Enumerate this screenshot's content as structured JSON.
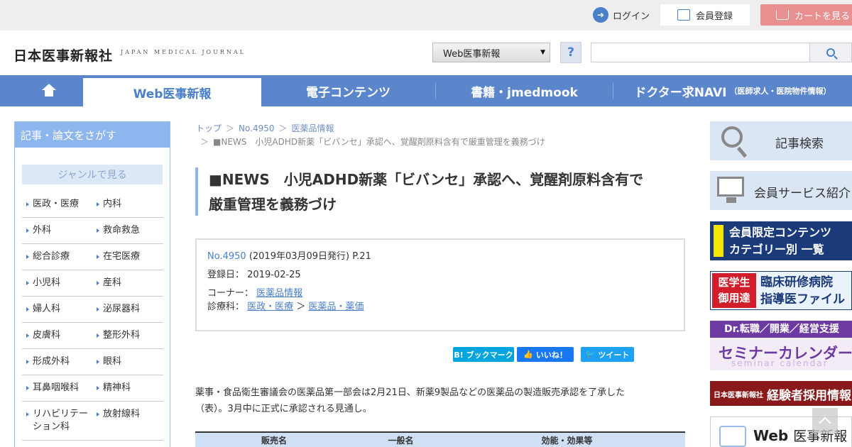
{
  "topbar": {
    "login": "ログイン",
    "register": "会員登録",
    "cart": "カートを見る"
  },
  "header": {
    "logo": "日本医事新報社",
    "logo_en": "JAPAN MEDICAL JOURNAL",
    "select_value": "Web医事新報",
    "help": "?",
    "search_placeholder": ""
  },
  "nav": {
    "items": [
      {
        "label": "Web医事新報"
      },
      {
        "label": "電子コンテンツ"
      },
      {
        "label": "書籍・jmedmook"
      },
      {
        "label": "ドクター求NAVI",
        "sub": "（医師求人・医院物件情報）"
      }
    ]
  },
  "sidebar": {
    "heading": "記事・論文をさがす",
    "genre_label": "ジャンルで見る",
    "categories": [
      [
        "医政・医療",
        "内科"
      ],
      [
        "外科",
        "救命救急"
      ],
      [
        "総合診療",
        "在宅医療"
      ],
      [
        "小児科",
        "産科"
      ],
      [
        "婦人科",
        "泌尿器科"
      ],
      [
        "皮膚科",
        "整形外科"
      ],
      [
        "形成外科",
        "眼科"
      ],
      [
        "耳鼻咽喉科",
        "精神科"
      ],
      [
        "リハビリテーション科",
        "放射線科"
      ]
    ]
  },
  "breadcrumb": {
    "items": [
      "トップ",
      "No.4950",
      "医薬品情報"
    ],
    "sep": "＞",
    "current": "■NEWS　小児ADHD新薬「ビバンセ」承認へ、覚醒剤原料含有で厳重管理を義務づけ"
  },
  "article": {
    "title_line1": "■NEWS　小児ADHD新薬「ビバンセ」承認へ、覚醒剤原料含有で",
    "title_line2": "厳重管理を義務づけ",
    "issue_link": "No.4950",
    "issue_meta": "(2019年03月09日発行) P.21",
    "registered_label": "登録日：",
    "registered_value": "2019-02-25",
    "corner_label": "コーナー：",
    "corner_value": "医薬品情報",
    "dept_label": "診療科：",
    "dept_value1": "医政・医療",
    "dept_sep": "＞",
    "dept_value2": "医薬品・薬価",
    "body_line1": "薬事・食品衛生審議会の医薬品第一部会は2月21日、新薬9製品などの医薬品の製造販売承認を了承した",
    "body_line2": "（表）。3月中に正式に承認される見通し。"
  },
  "share": {
    "hatena": "B! ブックマーク",
    "like": "いいね！",
    "tweet": "ツイート",
    "colors": {
      "hatena": "#00a4de",
      "like": "#1877f2",
      "tweet": "#1da1f2"
    }
  },
  "table": {
    "headers": [
      "販売名",
      "一般名",
      "効能・効果等"
    ]
  },
  "banners": {
    "search": "記事検索",
    "member": "会員サービス紹介",
    "limited_line1": "会員限定コンテンツ",
    "limited_line2": "カテゴリー別 一覧",
    "student_tag_line1": "医学生",
    "student_tag_line2": "御用達",
    "student_line1": "臨床研修病院",
    "student_line2": "指導医ファイル",
    "seminar_top": "Dr.転職／開業／経営支援",
    "seminar_title": "セミナーカレンダー",
    "seminar_sub": "seminar calendar",
    "recruit_small": "日本医事新報社",
    "recruit_title": "経験者採用情報",
    "web_title_en": "Web",
    "web_title_ja": "医事新報"
  }
}
